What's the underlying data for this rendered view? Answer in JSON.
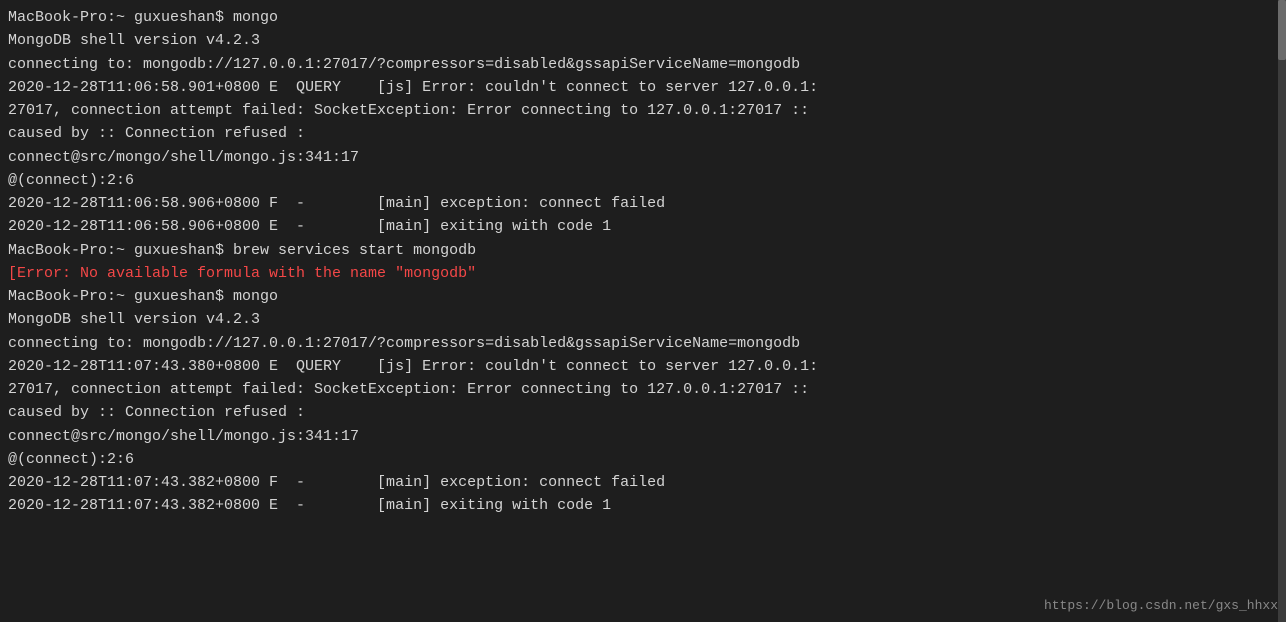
{
  "terminal": {
    "background": "#1e1e1e",
    "foreground": "#d4d4d4",
    "lines": [
      {
        "id": "l1",
        "text": "MacBook-Pro:~ guxueshan$ mongo",
        "type": "normal"
      },
      {
        "id": "l2",
        "text": "MongoDB shell version v4.2.3",
        "type": "normal"
      },
      {
        "id": "l3",
        "text": "connecting to: mongodb://127.0.0.1:27017/?compressors=disabled&gssapiServiceName=mongodb",
        "type": "normal"
      },
      {
        "id": "l4",
        "text": "2020-12-28T11:06:58.901+0800 E  QUERY    [js] Error: couldn't connect to server 127.0.0.1:",
        "type": "normal"
      },
      {
        "id": "l5",
        "text": "27017, connection attempt failed: SocketException: Error connecting to 127.0.0.1:27017 ::",
        "type": "normal"
      },
      {
        "id": "l6",
        "text": "caused by :: Connection refused :",
        "type": "normal"
      },
      {
        "id": "l7",
        "text": "connect@src/mongo/shell/mongo.js:341:17",
        "type": "normal"
      },
      {
        "id": "l8",
        "text": "@(connect):2:6",
        "type": "normal"
      },
      {
        "id": "l9",
        "text": "2020-12-28T11:06:58.906+0800 F  -        [main] exception: connect failed",
        "type": "normal"
      },
      {
        "id": "l10",
        "text": "2020-12-28T11:06:58.906+0800 E  -        [main] exiting with code 1",
        "type": "normal"
      },
      {
        "id": "l11",
        "text": "MacBook-Pro:~ guxueshan$ brew services start mongodb",
        "type": "normal"
      },
      {
        "id": "l12",
        "text": "[Error: No available formula with the name \"mongodb\"",
        "type": "error"
      },
      {
        "id": "l13",
        "text": "MacBook-Pro:~ guxueshan$ mongo",
        "type": "normal"
      },
      {
        "id": "l14",
        "text": "MongoDB shell version v4.2.3",
        "type": "normal"
      },
      {
        "id": "l15",
        "text": "connecting to: mongodb://127.0.0.1:27017/?compressors=disabled&gssapiServiceName=mongodb",
        "type": "normal"
      },
      {
        "id": "l16",
        "text": "2020-12-28T11:07:43.380+0800 E  QUERY    [js] Error: couldn't connect to server 127.0.0.1:",
        "type": "normal"
      },
      {
        "id": "l17",
        "text": "27017, connection attempt failed: SocketException: Error connecting to 127.0.0.1:27017 ::",
        "type": "normal"
      },
      {
        "id": "l18",
        "text": "caused by :: Connection refused :",
        "type": "normal"
      },
      {
        "id": "l19",
        "text": "connect@src/mongo/shell/mongo.js:341:17",
        "type": "normal"
      },
      {
        "id": "l20",
        "text": "@(connect):2:6",
        "type": "normal"
      },
      {
        "id": "l21",
        "text": "2020-12-28T11:07:43.382+0800 F  -        [main] exception: connect failed",
        "type": "normal"
      },
      {
        "id": "l22",
        "text": "2020-12-28T11:07:43.382+0800 E  -        [main] exiting with code 1",
        "type": "normal"
      }
    ],
    "watermark": "https://blog.csdn.net/gxs_hhxx"
  }
}
